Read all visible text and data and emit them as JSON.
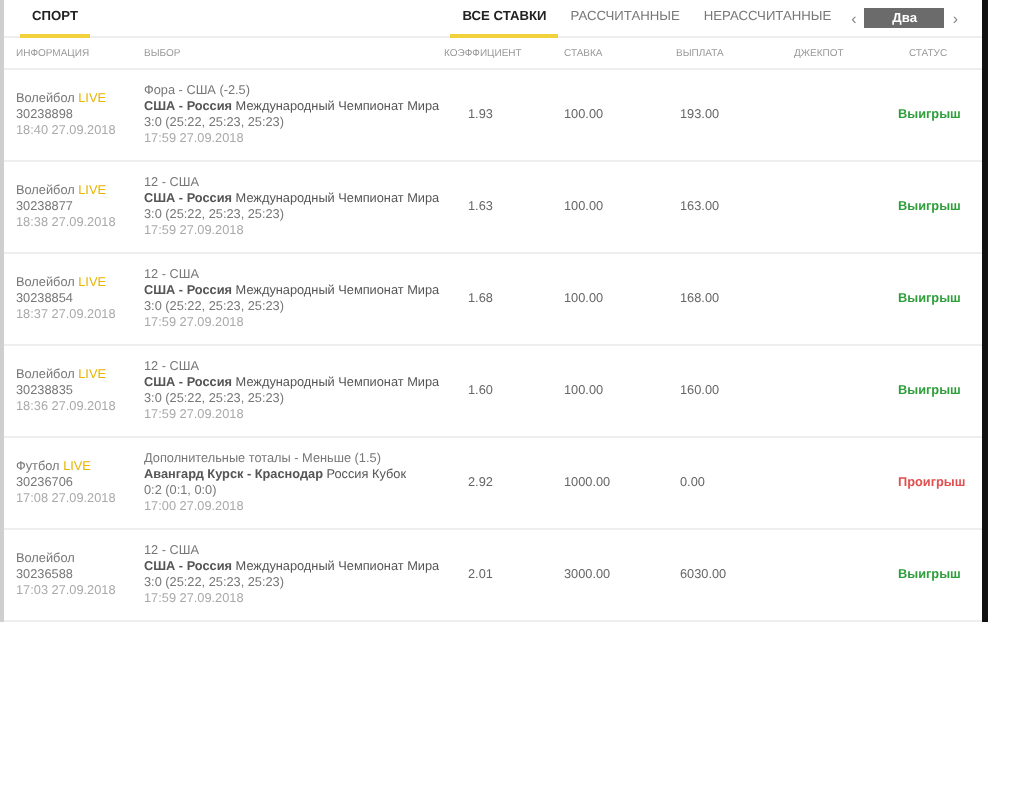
{
  "sport_tabs": [
    {
      "label": "СПОРТ",
      "selected": true
    }
  ],
  "filter_tabs": [
    {
      "label": "ВСЕ СТАВКИ",
      "selected": true
    },
    {
      "label": "РАССЧИТАННЫЕ",
      "selected": false
    },
    {
      "label": "НЕРАССЧИТАННЫЕ",
      "selected": false
    }
  ],
  "pager": {
    "prev": "‹",
    "current": "Два",
    "next": "›"
  },
  "columns": [
    "ИНФОРМАЦИЯ",
    "ВЫБОР",
    "КОЭФФИЦИЕНТ",
    "СТАВКА",
    "ВЫПЛАТА",
    "ДЖЕКПОТ",
    "СТАТУС"
  ],
  "bets": [
    {
      "sport": "Волейбол",
      "live_label": "LIVE",
      "id": "30238898",
      "placed": "18:40 27.09.2018",
      "pick": "Фора - США (-2.5)",
      "match": "**США - Россия** Международный Чемпионат Мира",
      "score": "3:0 (25:22, 25:23, 25:23)",
      "start": "17:59 27.09.2018",
      "coef": "1.93",
      "stake": "100.00",
      "payout": "193.00",
      "status": "Выигрыш",
      "kind": "win"
    },
    {
      "sport": "Волейбол",
      "live_label": "LIVE",
      "id": "30238877",
      "placed": "18:38 27.09.2018",
      "pick": "12 - США",
      "match": "**США - Россия** Международный Чемпионат Мира",
      "score": "3:0 (25:22, 25:23, 25:23)",
      "start": "17:59 27.09.2018",
      "coef": "1.63",
      "stake": "100.00",
      "payout": "163.00",
      "status": "Выигрыш",
      "kind": "win"
    },
    {
      "sport": "Волейбол",
      "live_label": "LIVE",
      "id": "30238854",
      "placed": "18:37 27.09.2018",
      "pick": "12 - США",
      "match": "**США - Россия** Международный Чемпионат Мира",
      "score": "3:0 (25:22, 25:23, 25:23)",
      "start": "17:59 27.09.2018",
      "coef": "1.68",
      "stake": "100.00",
      "payout": "168.00",
      "status": "Выигрыш",
      "kind": "win"
    },
    {
      "sport": "Волейбол",
      "live_label": "LIVE",
      "id": "30238835",
      "placed": "18:36 27.09.2018",
      "pick": "12 - США",
      "match": "**США - Россия** Международный Чемпионат Мира",
      "score": "3:0 (25:22, 25:23, 25:23)",
      "start": "17:59 27.09.2018",
      "coef": "1.60",
      "stake": "100.00",
      "payout": "160.00",
      "status": "Выигрыш",
      "kind": "win"
    },
    {
      "sport": "Футбол",
      "live_label": "LIVE",
      "id": "30236706",
      "placed": "17:08 27.09.2018",
      "pick": "Дополнительные тоталы - Меньше (1.5)",
      "match": "**Авангард Курск - Краснодар** Россия Кубок",
      "score": "0:2 (0:1, 0:0)",
      "start": "17:00 27.09.2018",
      "coef": "2.92",
      "stake": "1000.00",
      "payout": "0.00",
      "status": "Проигрыш",
      "kind": "loss"
    },
    {
      "sport": "Волейбол",
      "id": "30236588",
      "placed": "17:03 27.09.2018",
      "pick": "12 - США",
      "match": "**США - Россия** Международный Чемпионат Мира",
      "score": "3:0 (25:22, 25:23, 25:23)",
      "start": "17:59 27.09.2018",
      "coef": "2.01",
      "stake": "3000.00",
      "payout": "6030.00",
      "status": "Выигрыш",
      "kind": "win"
    }
  ]
}
